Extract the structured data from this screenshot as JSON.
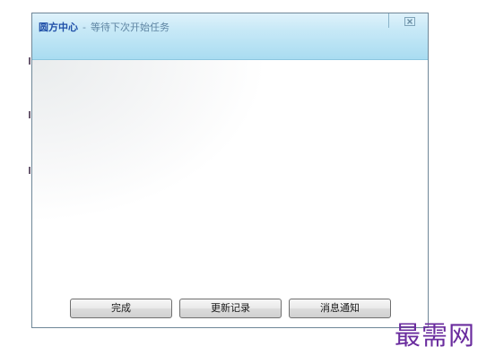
{
  "window": {
    "app_name": "圆方中心",
    "separator": "-",
    "status": "等待下次开始任务",
    "close_icon": "close-icon"
  },
  "buttons": {
    "done": "完成",
    "update_log": "更新记录",
    "notification": "消息通知"
  },
  "watermark": {
    "text": "最需网",
    "color": "#6a2c9e"
  },
  "colors": {
    "titlebar": "#bfe5f5",
    "app_name": "#1f4fa8",
    "status": "#5e85a3"
  }
}
